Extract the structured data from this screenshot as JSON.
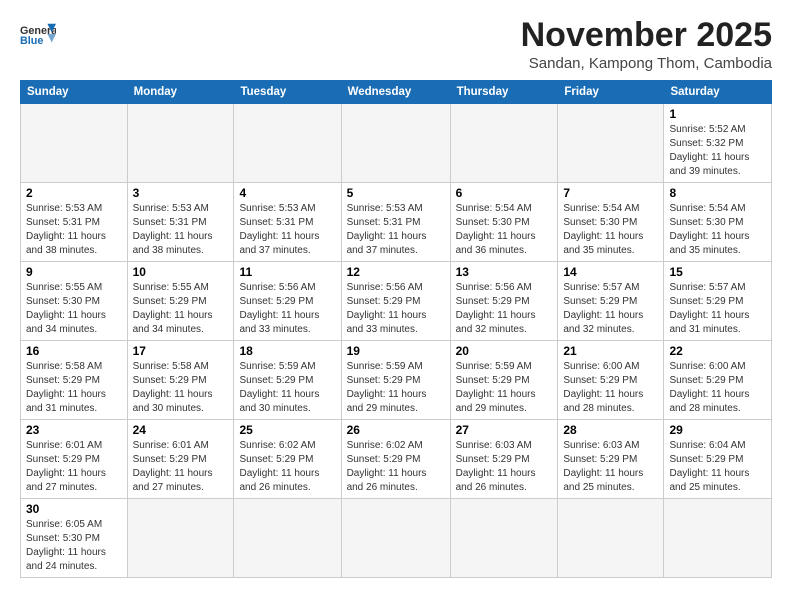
{
  "header": {
    "month_title": "November 2025",
    "subtitle": "Sandan, Kampong Thom, Cambodia",
    "logo_general": "General",
    "logo_blue": "Blue"
  },
  "days_of_week": [
    "Sunday",
    "Monday",
    "Tuesday",
    "Wednesday",
    "Thursday",
    "Friday",
    "Saturday"
  ],
  "weeks": [
    [
      {
        "day": "",
        "info": ""
      },
      {
        "day": "",
        "info": ""
      },
      {
        "day": "",
        "info": ""
      },
      {
        "day": "",
        "info": ""
      },
      {
        "day": "",
        "info": ""
      },
      {
        "day": "",
        "info": ""
      },
      {
        "day": "1",
        "info": "Sunrise: 5:52 AM\nSunset: 5:32 PM\nDaylight: 11 hours\nand 39 minutes."
      }
    ],
    [
      {
        "day": "2",
        "info": "Sunrise: 5:53 AM\nSunset: 5:31 PM\nDaylight: 11 hours\nand 38 minutes."
      },
      {
        "day": "3",
        "info": "Sunrise: 5:53 AM\nSunset: 5:31 PM\nDaylight: 11 hours\nand 38 minutes."
      },
      {
        "day": "4",
        "info": "Sunrise: 5:53 AM\nSunset: 5:31 PM\nDaylight: 11 hours\nand 37 minutes."
      },
      {
        "day": "5",
        "info": "Sunrise: 5:53 AM\nSunset: 5:31 PM\nDaylight: 11 hours\nand 37 minutes."
      },
      {
        "day": "6",
        "info": "Sunrise: 5:54 AM\nSunset: 5:30 PM\nDaylight: 11 hours\nand 36 minutes."
      },
      {
        "day": "7",
        "info": "Sunrise: 5:54 AM\nSunset: 5:30 PM\nDaylight: 11 hours\nand 35 minutes."
      },
      {
        "day": "8",
        "info": "Sunrise: 5:54 AM\nSunset: 5:30 PM\nDaylight: 11 hours\nand 35 minutes."
      }
    ],
    [
      {
        "day": "9",
        "info": "Sunrise: 5:55 AM\nSunset: 5:30 PM\nDaylight: 11 hours\nand 34 minutes."
      },
      {
        "day": "10",
        "info": "Sunrise: 5:55 AM\nSunset: 5:29 PM\nDaylight: 11 hours\nand 34 minutes."
      },
      {
        "day": "11",
        "info": "Sunrise: 5:56 AM\nSunset: 5:29 PM\nDaylight: 11 hours\nand 33 minutes."
      },
      {
        "day": "12",
        "info": "Sunrise: 5:56 AM\nSunset: 5:29 PM\nDaylight: 11 hours\nand 33 minutes."
      },
      {
        "day": "13",
        "info": "Sunrise: 5:56 AM\nSunset: 5:29 PM\nDaylight: 11 hours\nand 32 minutes."
      },
      {
        "day": "14",
        "info": "Sunrise: 5:57 AM\nSunset: 5:29 PM\nDaylight: 11 hours\nand 32 minutes."
      },
      {
        "day": "15",
        "info": "Sunrise: 5:57 AM\nSunset: 5:29 PM\nDaylight: 11 hours\nand 31 minutes."
      }
    ],
    [
      {
        "day": "16",
        "info": "Sunrise: 5:58 AM\nSunset: 5:29 PM\nDaylight: 11 hours\nand 31 minutes."
      },
      {
        "day": "17",
        "info": "Sunrise: 5:58 AM\nSunset: 5:29 PM\nDaylight: 11 hours\nand 30 minutes."
      },
      {
        "day": "18",
        "info": "Sunrise: 5:59 AM\nSunset: 5:29 PM\nDaylight: 11 hours\nand 30 minutes."
      },
      {
        "day": "19",
        "info": "Sunrise: 5:59 AM\nSunset: 5:29 PM\nDaylight: 11 hours\nand 29 minutes."
      },
      {
        "day": "20",
        "info": "Sunrise: 5:59 AM\nSunset: 5:29 PM\nDaylight: 11 hours\nand 29 minutes."
      },
      {
        "day": "21",
        "info": "Sunrise: 6:00 AM\nSunset: 5:29 PM\nDaylight: 11 hours\nand 28 minutes."
      },
      {
        "day": "22",
        "info": "Sunrise: 6:00 AM\nSunset: 5:29 PM\nDaylight: 11 hours\nand 28 minutes."
      }
    ],
    [
      {
        "day": "23",
        "info": "Sunrise: 6:01 AM\nSunset: 5:29 PM\nDaylight: 11 hours\nand 27 minutes."
      },
      {
        "day": "24",
        "info": "Sunrise: 6:01 AM\nSunset: 5:29 PM\nDaylight: 11 hours\nand 27 minutes."
      },
      {
        "day": "25",
        "info": "Sunrise: 6:02 AM\nSunset: 5:29 PM\nDaylight: 11 hours\nand 26 minutes."
      },
      {
        "day": "26",
        "info": "Sunrise: 6:02 AM\nSunset: 5:29 PM\nDaylight: 11 hours\nand 26 minutes."
      },
      {
        "day": "27",
        "info": "Sunrise: 6:03 AM\nSunset: 5:29 PM\nDaylight: 11 hours\nand 26 minutes."
      },
      {
        "day": "28",
        "info": "Sunrise: 6:03 AM\nSunset: 5:29 PM\nDaylight: 11 hours\nand 25 minutes."
      },
      {
        "day": "29",
        "info": "Sunrise: 6:04 AM\nSunset: 5:29 PM\nDaylight: 11 hours\nand 25 minutes."
      }
    ],
    [
      {
        "day": "30",
        "info": "Sunrise: 6:05 AM\nSunset: 5:30 PM\nDaylight: 11 hours\nand 24 minutes."
      },
      {
        "day": "",
        "info": ""
      },
      {
        "day": "",
        "info": ""
      },
      {
        "day": "",
        "info": ""
      },
      {
        "day": "",
        "info": ""
      },
      {
        "day": "",
        "info": ""
      },
      {
        "day": "",
        "info": ""
      }
    ]
  ]
}
